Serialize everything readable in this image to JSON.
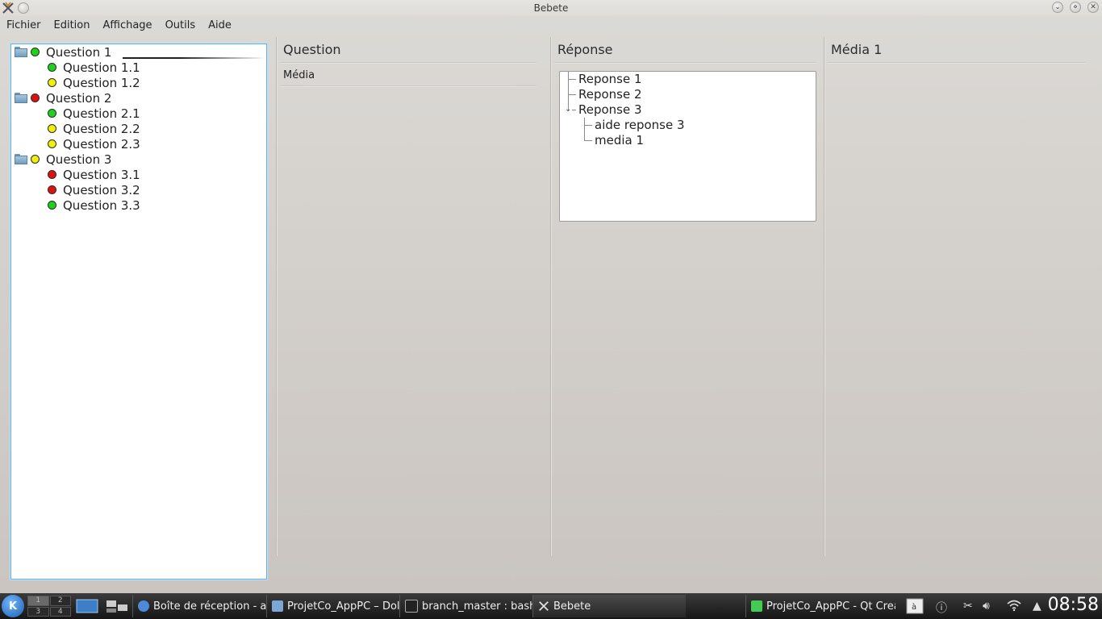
{
  "window": {
    "title": "Bebete"
  },
  "menu": [
    "Fichier",
    "Edition",
    "Affichage",
    "Outils",
    "Aide"
  ],
  "question_tree": [
    {
      "label": "Question 1",
      "status": "green",
      "level": 0,
      "folder": true
    },
    {
      "label": "Question 1.1",
      "status": "green",
      "level": 1,
      "folder": false
    },
    {
      "label": "Question 1.2",
      "status": "yellow",
      "level": 1,
      "folder": false
    },
    {
      "label": "Question 2",
      "status": "red",
      "level": 0,
      "folder": true
    },
    {
      "label": "Question 2.1",
      "status": "green",
      "level": 1,
      "folder": false
    },
    {
      "label": "Question 2.2",
      "status": "yellow",
      "level": 1,
      "folder": false
    },
    {
      "label": "Question 2.3",
      "status": "yellow",
      "level": 1,
      "folder": false
    },
    {
      "label": "Question 3",
      "status": "yellow",
      "level": 0,
      "folder": true
    },
    {
      "label": "Question 3.1",
      "status": "red",
      "level": 1,
      "folder": false
    },
    {
      "label": "Question 3.2",
      "status": "red",
      "level": 1,
      "folder": false
    },
    {
      "label": "Question 3.3",
      "status": "green",
      "level": 1,
      "folder": false
    }
  ],
  "columns": {
    "question": {
      "title": "Question",
      "media_label": "Média"
    },
    "reponse": {
      "title": "Réponse",
      "items": [
        "Reponse 1",
        "Reponse 2",
        "Reponse 3"
      ],
      "children": [
        "aide reponse 3",
        "media 1"
      ]
    },
    "media": {
      "title": "Média 1"
    }
  },
  "taskbar": {
    "pager": [
      "1",
      "2",
      "3",
      "4"
    ],
    "tasks": [
      "Boîte de réception - ar",
      "ProjetCo_AppPC – Dolph",
      "branch_master : bash",
      "Bebete",
      "ProjetCo_AppPC - Qt Crea"
    ],
    "clock": "08:58"
  },
  "colors": {
    "green": "#19d419",
    "yellow": "#f0f000",
    "red": "#e01010",
    "accent": "#5fb4ea"
  }
}
